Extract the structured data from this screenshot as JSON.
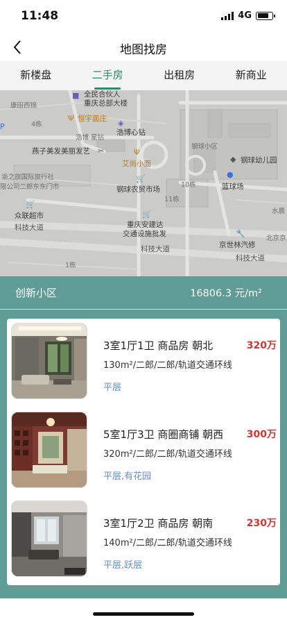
{
  "status": {
    "time": "11:48",
    "network": "4G"
  },
  "nav": {
    "title": "地图找房"
  },
  "tabs": [
    {
      "label": "新楼盘",
      "active": false
    },
    {
      "label": "二手房",
      "active": true
    },
    {
      "label": "出租房",
      "active": false
    },
    {
      "label": "新商业",
      "active": false
    }
  ],
  "map": {
    "labels": {
      "quanmin": "全民合伙人",
      "chongqing_hq": "重庆总部大楼",
      "kangtian": "康田西锦",
      "hengyu": "恒宇面庄",
      "num4": "4栋",
      "haobo_x": "浩博·星钻",
      "haobo_heart": "浩博心钻",
      "yanzi": "燕子美发美丽发艺",
      "gangqiu_xiaoqu": "钢球小区",
      "aishang": "艾尚小面",
      "gangqiu_kindergarten": "钢球幼儿园",
      "yuzhilv": "渝之旅国际旅行社",
      "erlang_ltd": "限公司二郎东东门市",
      "num10": "10栋",
      "lanqiuchang": "篮球场",
      "gangqiu_market": "钢球农贸市场",
      "num11": "11栋",
      "shuichen": "水晨",
      "zhonglian": "众联超市",
      "keji_road1": "科技大道",
      "anjian": "重庆安建达",
      "jiaotong": "交通设施批发",
      "beijing_jing": "北京京",
      "jingshilin": "京世林汽修",
      "keji_road2": "科技大道",
      "keji_road3": "科技大道",
      "num1": "1栋",
      "shequ_num": "4栋"
    }
  },
  "summary": {
    "name": "创新小区",
    "price": "16806.3 元/m²"
  },
  "listings": [
    {
      "title": "3室1厅1卫 商品房 朝北",
      "price": "320万",
      "meta": "130m²/二郎/二郎/轨道交通环线",
      "tags": "平层"
    },
    {
      "title": "5室1厅3卫 商圈商铺 朝西",
      "price": "300万",
      "meta": "320m²/二郎/二郎/轨道交通环线",
      "tags": "平层,有花园"
    },
    {
      "title": "3室1厅2卫 商品房 朝南",
      "price": "230万",
      "meta": "140m²/二郎/二郎/轨道交通环线",
      "tags": "平层,跃层"
    }
  ],
  "colors": {
    "accent": "#2e8b66",
    "price": "#d83232",
    "teal": "#5f9c96",
    "tag": "#6b8cc9"
  },
  "icons": [
    "back-arrow-icon",
    "signal-icon",
    "battery-icon",
    "shopping-cart-icon",
    "restaurant-icon",
    "wrench-icon",
    "basketball-icon",
    "school-icon",
    "hair-salon-icon"
  ]
}
